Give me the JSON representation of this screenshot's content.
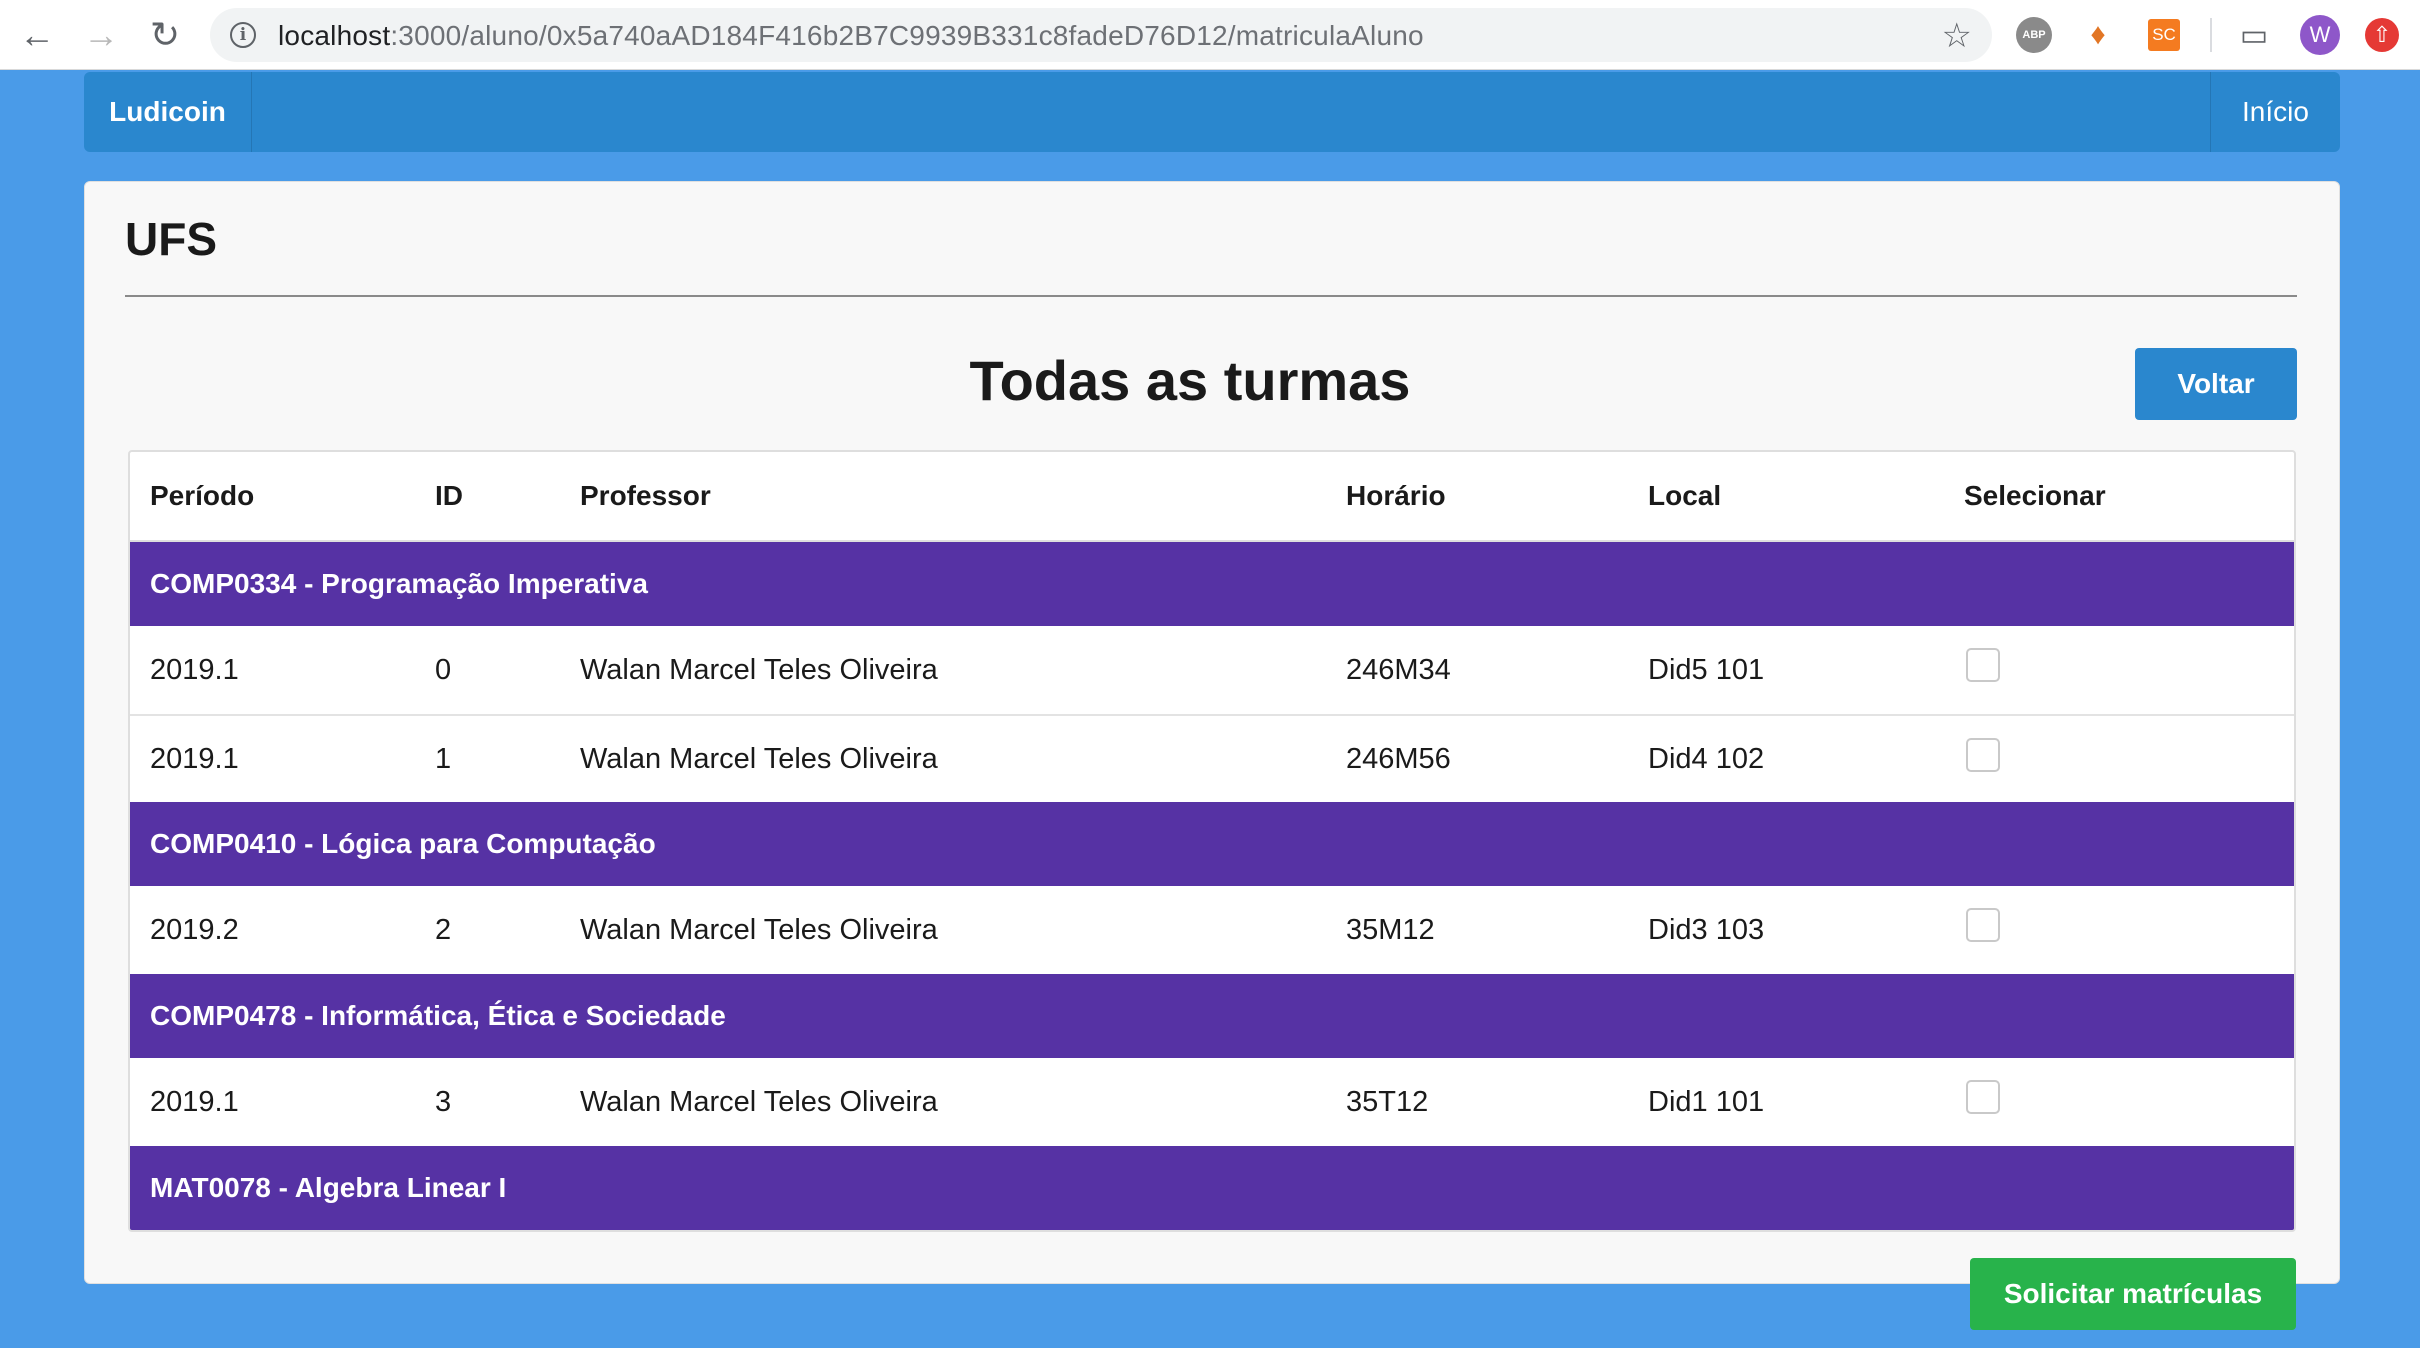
{
  "browser": {
    "url_host": "localhost",
    "url_path": ":3000/aluno/0x5a740aAD184F416b2B7C9939B331c8fadeD76D12/matriculaAluno",
    "extensions": {
      "abp": "ABP",
      "sc": "SC",
      "avatar": "W"
    }
  },
  "navbar": {
    "brand": "Ludicoin",
    "home": "Início"
  },
  "card": {
    "title": "UFS"
  },
  "section": {
    "title": "Todas as turmas",
    "back_button": "Voltar"
  },
  "table": {
    "headers": [
      "Período",
      "ID",
      "Professor",
      "Horário",
      "Local",
      "Selecionar"
    ],
    "groups": [
      {
        "name": "COMP0334 - Programação Imperativa",
        "rows": [
          {
            "periodo": "2019.1",
            "id": "0",
            "professor": "Walan Marcel Teles Oliveira",
            "horario": "246M34",
            "local": "Did5 101",
            "selected": false
          },
          {
            "periodo": "2019.1",
            "id": "1",
            "professor": "Walan Marcel Teles Oliveira",
            "horario": "246M56",
            "local": "Did4 102",
            "selected": false
          }
        ]
      },
      {
        "name": "COMP0410 - Lógica para Computação",
        "rows": [
          {
            "periodo": "2019.2",
            "id": "2",
            "professor": "Walan Marcel Teles Oliveira",
            "horario": "35M12",
            "local": "Did3 103",
            "selected": false
          }
        ]
      },
      {
        "name": "COMP0478 - Informática, Ética e Sociedade",
        "rows": [
          {
            "periodo": "2019.1",
            "id": "3",
            "professor": "Walan Marcel Teles Oliveira",
            "horario": "35T12",
            "local": "Did1 101",
            "selected": false
          }
        ]
      },
      {
        "name": "MAT0078 - Algebra Linear I",
        "rows": []
      }
    ]
  },
  "actions": {
    "submit_button": "Solicitar matrículas"
  },
  "colors": {
    "background": "#4a9be8",
    "navbar": "#2a87ce",
    "group_row": "#5632a4",
    "primary_button": "#2a87ce",
    "success_button": "#28b34b"
  }
}
